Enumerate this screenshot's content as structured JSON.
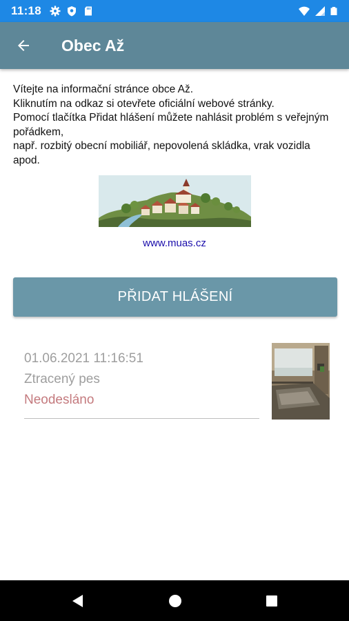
{
  "status_bar": {
    "time": "11:18",
    "left_icons": [
      "gear-icon",
      "shield-icon",
      "sd-card-icon"
    ],
    "right_icons": [
      "wifi-icon",
      "signal-icon",
      "battery-icon"
    ],
    "background": "#1e88e5"
  },
  "app_bar": {
    "back_icon": "arrow-left-icon",
    "title": "Obec Až",
    "background": "#5e8798"
  },
  "intro": {
    "lines": [
      "Vítejte na informační stránce obce Až.",
      "Kliknutím na odkaz  si otevřete oficiální webové stránky.",
      "Pomocí tlačítka Přidat hlášení můžete nahlásit problém s veřejným pořádkem,",
      "např. rozbitý obecní mobiliář, nepovolená skládka, vrak vozidla apod."
    ]
  },
  "banner": {
    "image": "village-landscape-illustration"
  },
  "link": {
    "text": "www.muas.cz",
    "color": "#1a0dab"
  },
  "add_button": {
    "label": "PŘIDAT HLÁŠENÍ",
    "background": "#6a97a8"
  },
  "reports": [
    {
      "date": "01.06.2021 11:16:51",
      "title": "Ztracený pes",
      "status": "Neodesláno",
      "status_color": "#c47a7e",
      "thumbnail": "room-photo"
    }
  ],
  "nav_bar": {
    "buttons": [
      "back-triangle-icon",
      "home-circle-icon",
      "recents-square-icon"
    ]
  }
}
